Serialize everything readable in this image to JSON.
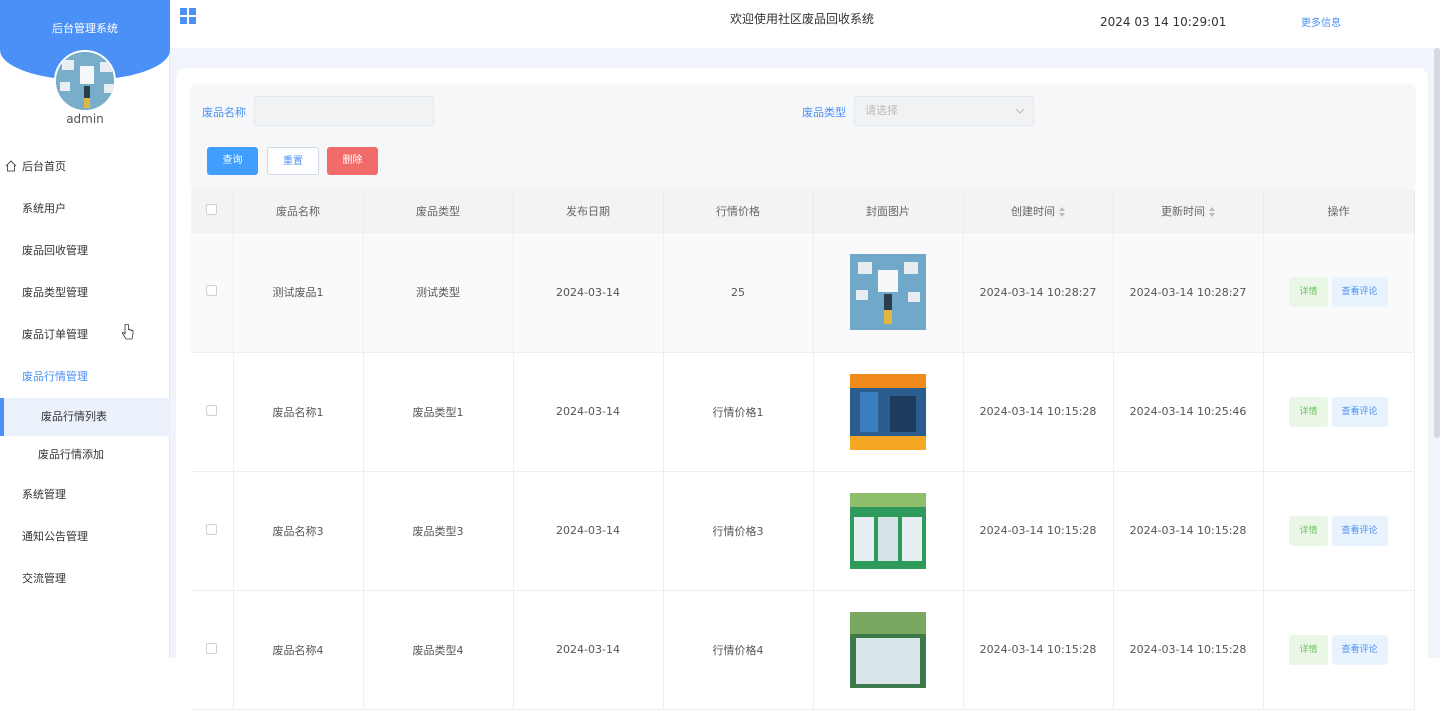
{
  "sidebar": {
    "title": "后台管理系统",
    "username": "admin",
    "menu": [
      {
        "label": "后台首页"
      },
      {
        "label": "系统用户"
      },
      {
        "label": "废品回收管理"
      },
      {
        "label": "废品类型管理"
      },
      {
        "label": "废品订单管理"
      },
      {
        "label": "废品行情管理"
      }
    ],
    "submenu": [
      {
        "label": "废品行情列表"
      },
      {
        "label": "废品行情添加"
      }
    ],
    "menu_after": [
      {
        "label": "系统管理"
      },
      {
        "label": "通知公告管理"
      },
      {
        "label": "交流管理"
      }
    ]
  },
  "header": {
    "title": "欢迎使用社区废品回收系统",
    "datetime": "2024 03 14 10:29:01",
    "more": "更多信息"
  },
  "search": {
    "name_label": "废品名称",
    "name_value": "",
    "type_label": "废品类型",
    "type_placeholder": "请选择",
    "query": "查询",
    "reset": "重置",
    "delete": "删除"
  },
  "table": {
    "headers": [
      "废品名称",
      "废品类型",
      "发布日期",
      "行情价格",
      "封面图片",
      "创建时间",
      "更新时间",
      "操作"
    ],
    "rows": [
      {
        "name": "测试废品1",
        "type": "测试类型",
        "date": "2024-03-14",
        "price": "25",
        "created": "2024-03-14 10:28:27",
        "updated": "2024-03-14 10:28:27",
        "detail": "详情",
        "review": "查看评论"
      },
      {
        "name": "废品名称1",
        "type": "废品类型1",
        "date": "2024-03-14",
        "price": "行情价格1",
        "created": "2024-03-14 10:15:28",
        "updated": "2024-03-14 10:25:46",
        "detail": "详情",
        "review": "查看评论"
      },
      {
        "name": "废品名称3",
        "type": "废品类型3",
        "date": "2024-03-14",
        "price": "行情价格3",
        "created": "2024-03-14 10:15:28",
        "updated": "2024-03-14 10:15:28",
        "detail": "详情",
        "review": "查看评论"
      },
      {
        "name": "废品名称4",
        "type": "废品类型4",
        "date": "2024-03-14",
        "price": "行情价格4",
        "created": "2024-03-14 10:15:28",
        "updated": "2024-03-14 10:15:28",
        "detail": "详情",
        "review": "查看评论"
      }
    ]
  },
  "colors": {
    "accent": "#4a90f7",
    "danger": "#f26b6b",
    "success": "#6cc15f"
  }
}
